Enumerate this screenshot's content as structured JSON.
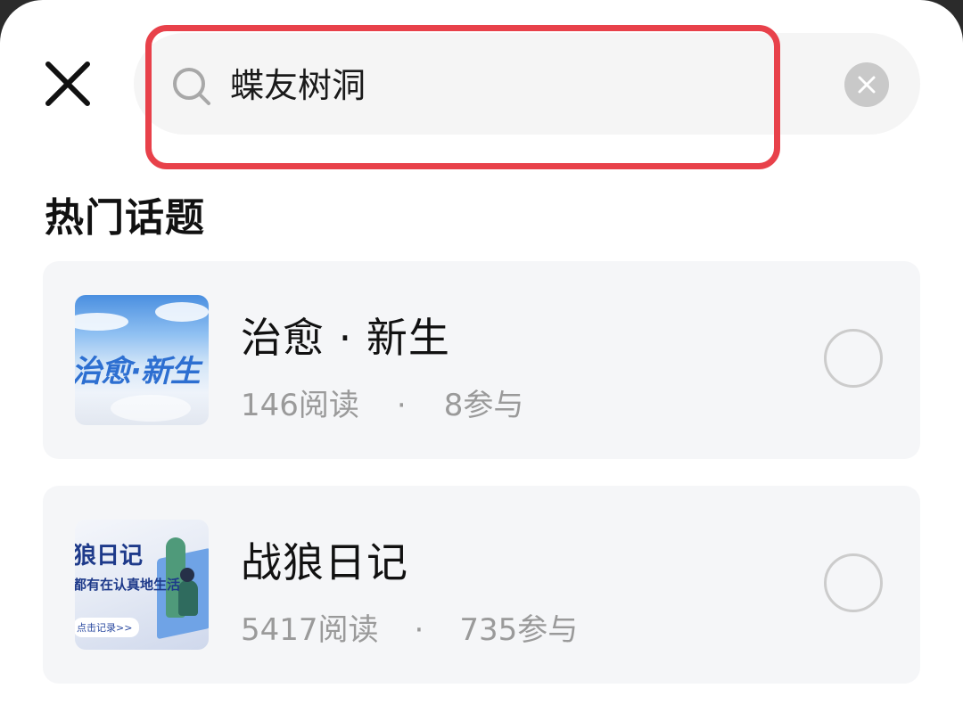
{
  "search": {
    "value": "蝶友树洞"
  },
  "section": {
    "title": "热门话题"
  },
  "topics": [
    {
      "title": "治愈 · 新生",
      "reads": "146阅读",
      "separator": "·",
      "participants": "8参与",
      "thumbnail_text": "治愈·新生",
      "selected": false
    },
    {
      "title": "战狼日记",
      "reads": "5417阅读",
      "separator": "·",
      "participants": "735参与",
      "thumbnail_text": "狼日记",
      "thumbnail_subtext": "都有在认真地生活",
      "thumbnail_button": "点击记录>>",
      "selected": false
    }
  ],
  "icons": {
    "close": "close-icon",
    "search": "search-icon",
    "clear": "clear-icon"
  },
  "colors": {
    "highlight": "#e8414a",
    "card_background": "#f5f6f8",
    "meta_text": "#9a9a9a"
  }
}
